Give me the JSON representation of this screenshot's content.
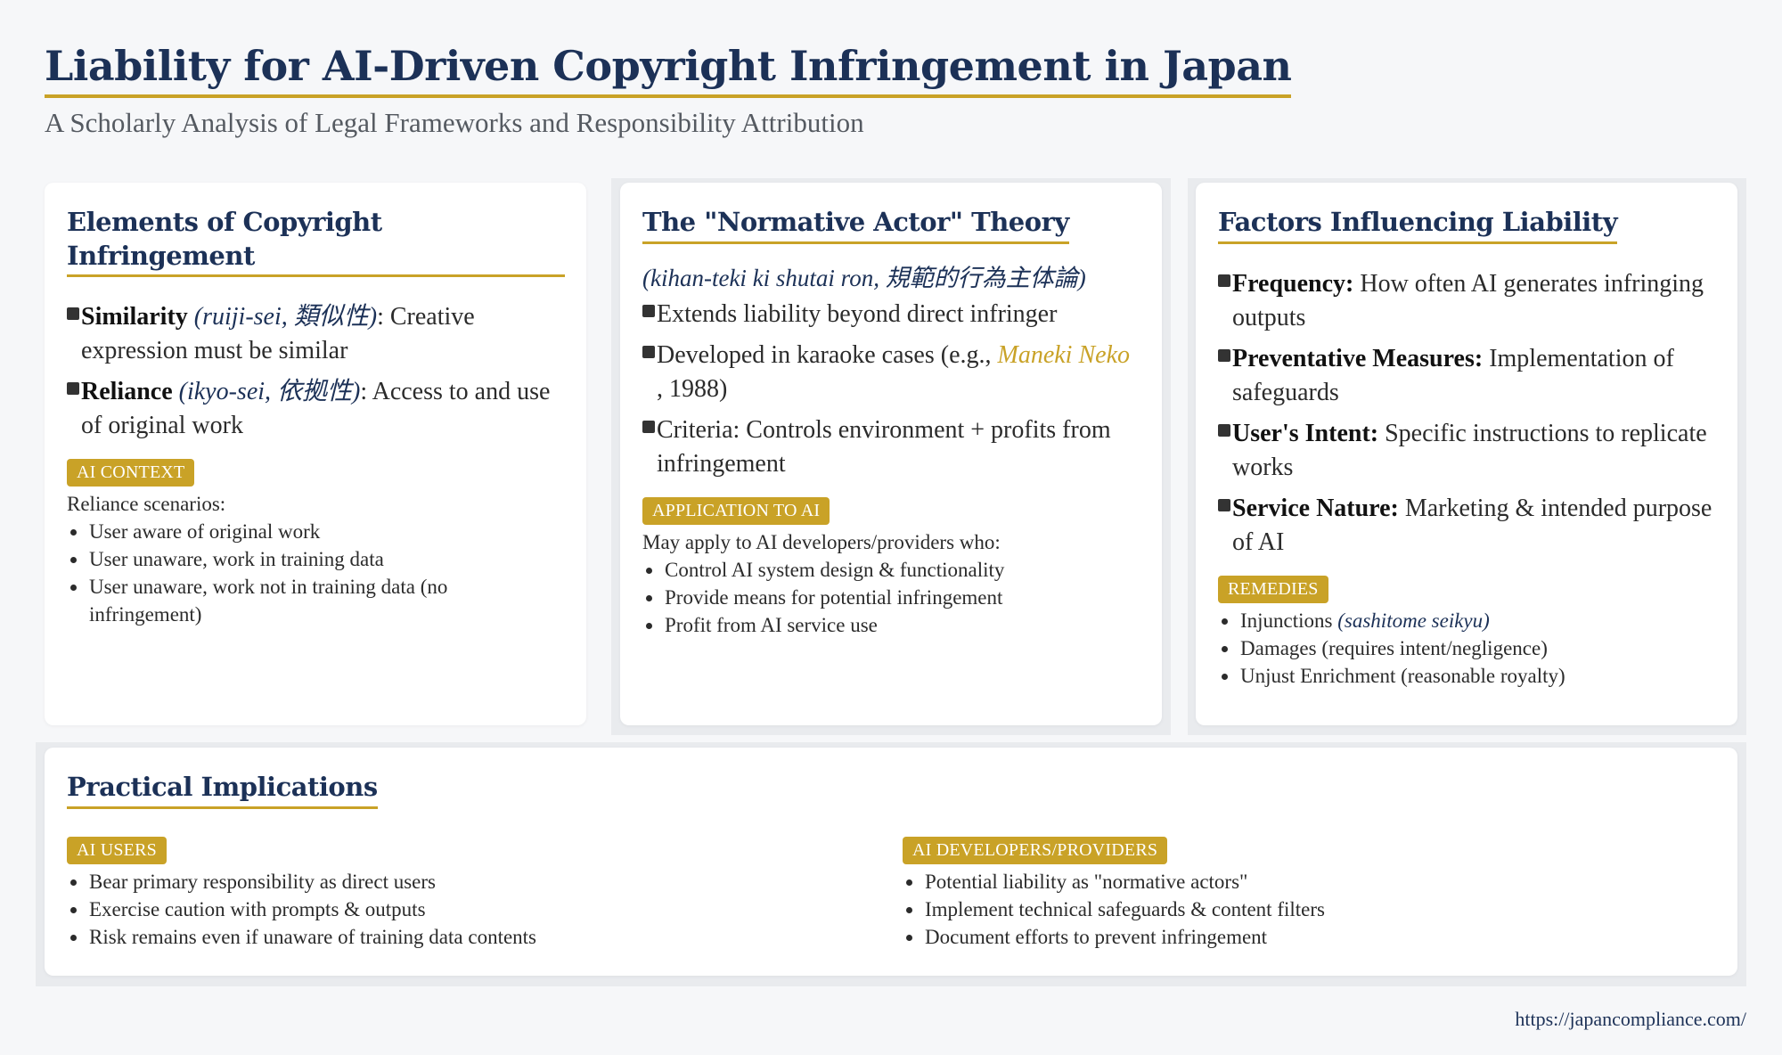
{
  "header": {
    "title": "Liability for AI-Driven Copyright Infringement in Japan",
    "subtitle": "A Scholarly Analysis of Legal Frameworks and Responsibility Attribution"
  },
  "elements_card": {
    "title": "Elements of Copyright Infringement",
    "items": [
      {
        "label": "Similarity",
        "term": "(ruiji-sei, 類似性)",
        "text": ": Creative expression must be similar"
      },
      {
        "label": "Reliance",
        "term": "(ikyo-sei, 依拠性)",
        "text": ": Access to and use of original work"
      }
    ],
    "badge": "AI CONTEXT",
    "intro": "Reliance scenarios:",
    "bullets": [
      "User aware of original work",
      "User unaware, work in training data",
      "User unaware, work not in training data (no infringement)"
    ]
  },
  "normative_card": {
    "title": "The \"Normative Actor\" Theory",
    "subtitle": "(kihan-teki ki shutai ron, 規範的行為主体論)",
    "item1": "Extends liability beyond direct infringer",
    "item2_pre": "Developed in karaoke cases (e.g., ",
    "item2_link": "Maneki Neko",
    "item2_post": " , 1988)",
    "item3": "Criteria: Controls environment + profits from infringement",
    "badge": "APPLICATION TO AI",
    "intro": "May apply to AI developers/providers who:",
    "bullets": [
      "Control AI system design & functionality",
      "Provide means for potential infringement",
      "Profit from AI service use"
    ]
  },
  "factors_card": {
    "title": "Factors Influencing Liability",
    "items": [
      {
        "label": "Frequency:",
        "text": " How often AI generates infringing outputs"
      },
      {
        "label": "Preventative Measures:",
        "text": " Implementation of safeguards"
      },
      {
        "label": "User's Intent:",
        "text": " Specific instructions to replicate works"
      },
      {
        "label": "Service Nature:",
        "text": " Marketing & intended purpose of AI"
      }
    ],
    "badge": "REMEDIES",
    "bullet1_pre": "Injunctions ",
    "bullet1_term": "(sashitome seikyu)",
    "bullet2": "Damages (requires intent/negligence)",
    "bullet3": "Unjust Enrichment (reasonable royalty)"
  },
  "implications_card": {
    "title": "Practical Implications",
    "users": {
      "badge": "AI USERS",
      "bullets": [
        "Bear primary responsibility as direct users",
        "Exercise caution with prompts & outputs",
        "Risk remains even if unaware of training data contents"
      ]
    },
    "developers": {
      "badge": "AI DEVELOPERS/PROVIDERS",
      "bullets": [
        "Potential liability as \"normative actors\"",
        "Implement technical safeguards & content filters",
        "Document efforts to prevent infringement"
      ]
    }
  },
  "footer": {
    "url": "https://japancompliance.com/"
  }
}
